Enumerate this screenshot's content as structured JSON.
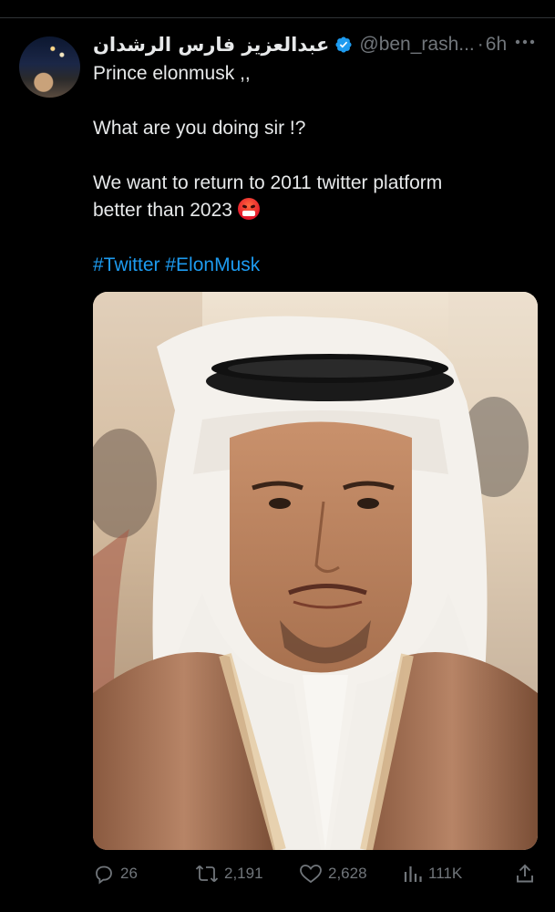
{
  "tweet": {
    "display_name": "عبدالعزيز فارس الرشدان",
    "handle": "@ben_rash...",
    "separator": "·",
    "time": "6h",
    "lines": [
      "Prince elonmusk ,,",
      "What are you doing sir !?",
      "We want to return to 2011 twitter platform",
      "better than 2023"
    ],
    "hashtags": [
      "#Twitter",
      "#ElonMusk"
    ]
  },
  "icons": {
    "verified": "verified-badge-icon",
    "more": "more-icon",
    "reply": "reply-icon",
    "retweet": "retweet-icon",
    "like": "like-icon",
    "views": "views-icon",
    "share": "share-icon",
    "emoji": "angry-face-emoji"
  },
  "actions": {
    "replies": "26",
    "retweets": "2,191",
    "likes": "2,628",
    "views": "111K"
  },
  "colors": {
    "background": "#000000",
    "text": "#e7e9ea",
    "muted": "#71767b",
    "accent": "#1d9bf0"
  }
}
